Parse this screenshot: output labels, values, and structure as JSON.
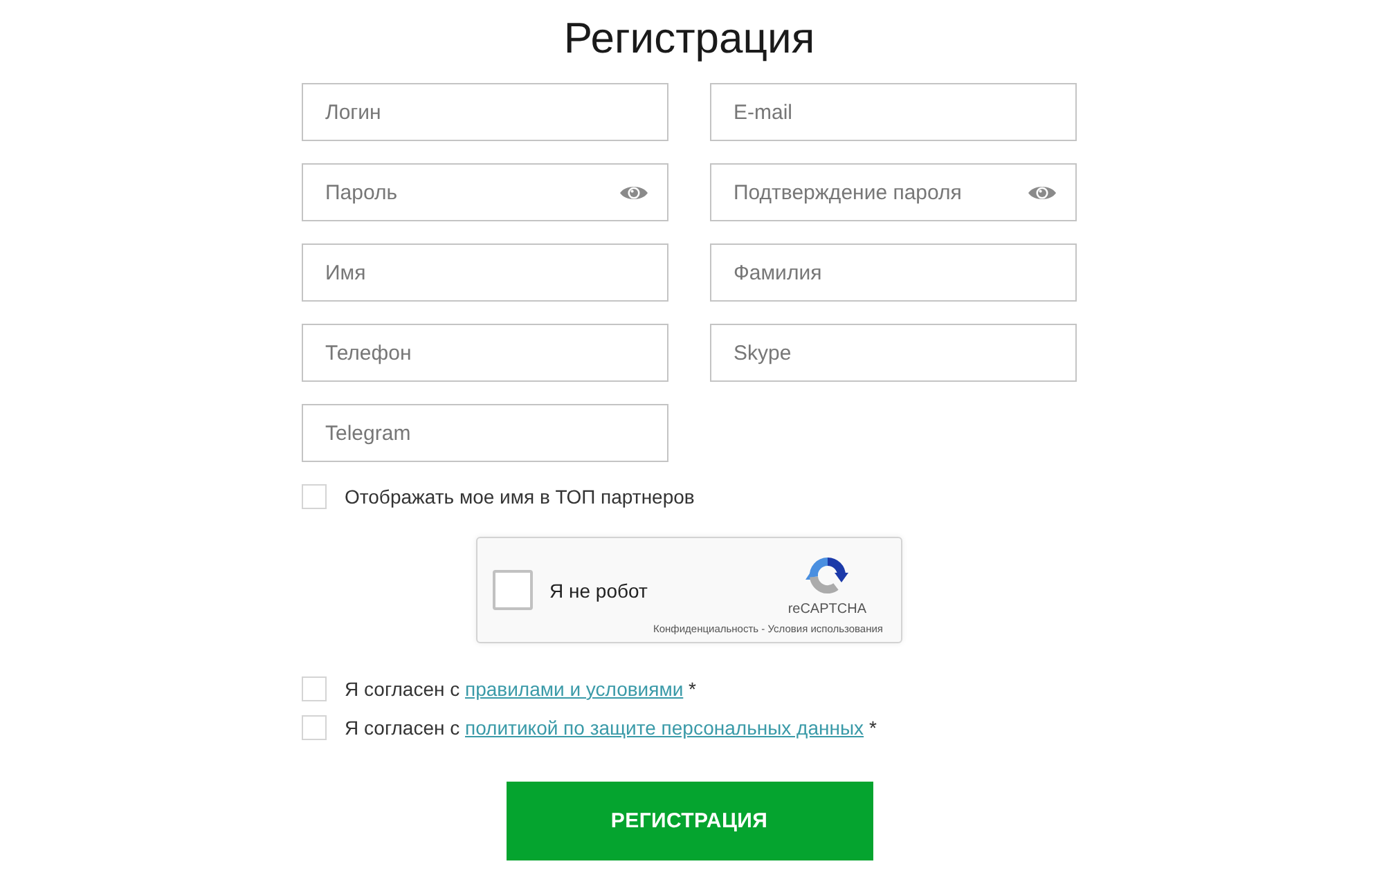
{
  "title": "Регистрация",
  "fields": [
    {
      "kind": "text",
      "placeholder": "Логин"
    },
    {
      "kind": "text",
      "placeholder": "E-mail"
    },
    {
      "kind": "password",
      "placeholder": "Пароль"
    },
    {
      "kind": "password",
      "placeholder": "Подтверждение пароля"
    },
    {
      "kind": "text",
      "placeholder": "Имя"
    },
    {
      "kind": "text",
      "placeholder": "Фамилия"
    },
    {
      "kind": "text",
      "placeholder": "Телефон"
    },
    {
      "kind": "text",
      "placeholder": "Skype"
    },
    {
      "kind": "text",
      "placeholder": "Telegram"
    }
  ],
  "show_in_top": {
    "label": "Отображать мое имя в ТОП партнеров",
    "checked": false
  },
  "captcha": {
    "label": "Я не робот",
    "checked": false,
    "brand": "reCAPTCHA",
    "privacy_link": "Конфиденциальность",
    "separator": "-",
    "terms_link": "Условия использования"
  },
  "agreements": [
    {
      "text": "Я согласен с",
      "link": "правилами и условиями",
      "required_mark": "*",
      "checked": false
    },
    {
      "text": "Я согласен с",
      "link": "политикой по защите персональных данных",
      "required_mark": "*",
      "checked": false
    }
  ],
  "submit": {
    "label": "РЕГИСТРАЦИЯ"
  }
}
